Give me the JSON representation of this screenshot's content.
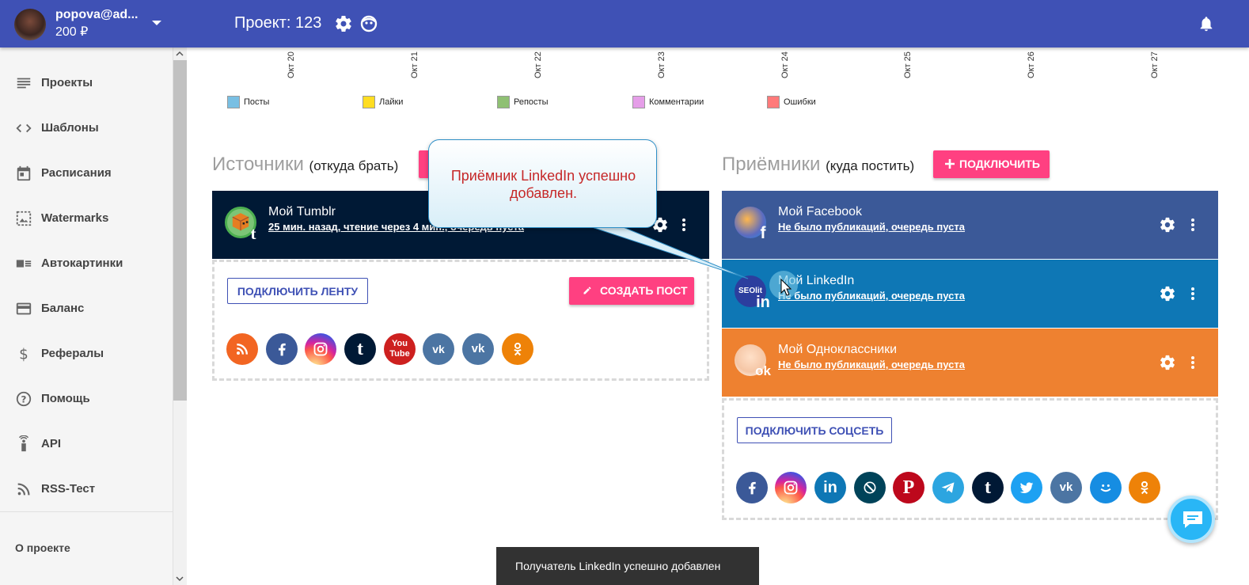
{
  "header": {
    "user_email": "popova@ad...",
    "balance": "200 ₽",
    "project_title": "Проект: 123"
  },
  "sidebar": {
    "items": [
      {
        "label": "Проекты",
        "icon": "list-icon"
      },
      {
        "label": "Шаблоны",
        "icon": "code-icon"
      },
      {
        "label": "Расписания",
        "icon": "calendar-icon"
      },
      {
        "label": "Watermarks",
        "icon": "image-icon"
      },
      {
        "label": "Автокартинки",
        "icon": "photo-text-icon"
      },
      {
        "label": "Баланс",
        "icon": "credit-card-icon"
      },
      {
        "label": "Рефералы",
        "icon": "dollar-icon"
      },
      {
        "label": "Помощь",
        "icon": "help-icon"
      },
      {
        "label": "API",
        "icon": "wireless-icon"
      },
      {
        "label": "RSS-Тест",
        "icon": "rss-icon"
      }
    ],
    "about": "О проекте"
  },
  "chart": {
    "dates": [
      "Окт 20",
      "Окт 21",
      "Окт 22",
      "Окт 23",
      "Окт 24",
      "Окт 25",
      "Окт 26",
      "Окт 27"
    ],
    "legend": [
      {
        "label": "Посты",
        "color": "#79bfe3"
      },
      {
        "label": "Лайки",
        "color": "#ffdd22"
      },
      {
        "label": "Репосты",
        "color": "#8fc073"
      },
      {
        "label": "Комментарии",
        "color": "#e59ee8"
      },
      {
        "label": "Ошибки",
        "color": "#ff7a7a"
      }
    ]
  },
  "sources": {
    "title": "Источники",
    "subtitle": "(откуда брать)",
    "card": {
      "name": "Мой Tumblr",
      "status": "25 мин. назад, чтение через 4 мин., очередь пуста"
    },
    "connect_feed_label": "ПОДКЛЮЧИТЬ ЛЕНТУ",
    "create_post_label": "СОЗДАТЬ ПОСТ",
    "icons": [
      "rss-icon",
      "facebook-icon",
      "instagram-icon",
      "tumblr-icon",
      "youtube-icon",
      "vk-market-icon",
      "vk-icon",
      "odnoklassniki-icon"
    ]
  },
  "receivers": {
    "title": "Приёмники",
    "subtitle": "(куда постить)",
    "connect_label": "ПОДКЛЮЧИТЬ",
    "cards": [
      {
        "name": "Мой Facebook",
        "status": "Не было публикаций, очередь пуста",
        "color": "#3b5998"
      },
      {
        "name": "Мой LinkedIn",
        "status": "Не было публикаций, очередь пуста",
        "color": "#0e77b5"
      },
      {
        "name": "Мой Одноклассники",
        "status": "Не было публикаций, очередь пуста",
        "color": "#ee8130"
      }
    ],
    "connect_social_label": "ПОДКЛЮЧИТЬ СОЦСЕТЬ",
    "icons": [
      "facebook-icon",
      "instagram-icon",
      "linkedin-icon",
      "livejournal-icon",
      "pinterest-icon",
      "telegram-icon",
      "tumblr-icon",
      "twitter-icon",
      "vk-icon",
      "moimir-icon",
      "odnoklassniki-icon"
    ]
  },
  "tooltip": {
    "line1": "Приёмник LinkedIn успешно",
    "line2": "добавлен."
  },
  "snackbar": {
    "text": "Получатель LinkedIn успешно добавлен"
  }
}
